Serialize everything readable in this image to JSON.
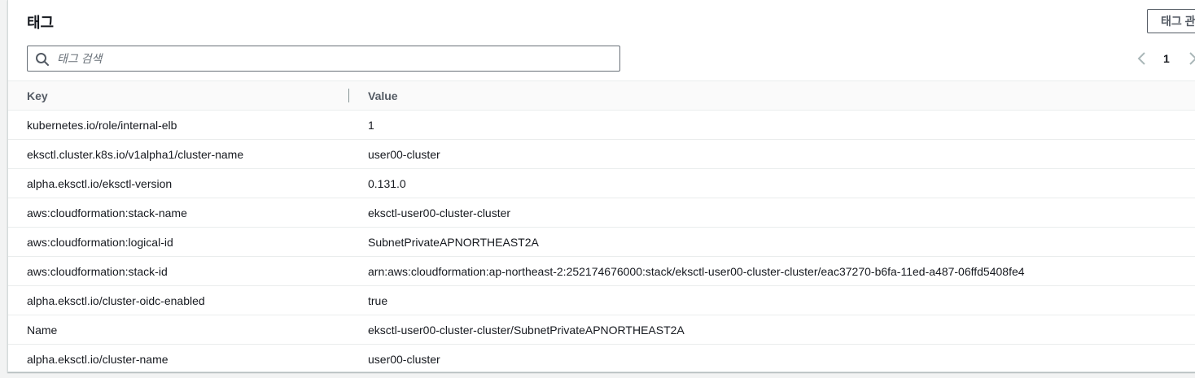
{
  "panel": {
    "title": "태그",
    "manage_button_label": "태그 관리"
  },
  "search": {
    "placeholder": "태그 검색",
    "value": ""
  },
  "pagination": {
    "current_page": "1"
  },
  "table": {
    "columns": [
      "Key",
      "Value"
    ],
    "rows": [
      {
        "key": "kubernetes.io/role/internal-elb",
        "value": "1"
      },
      {
        "key": "eksctl.cluster.k8s.io/v1alpha1/cluster-name",
        "value": "user00-cluster"
      },
      {
        "key": "alpha.eksctl.io/eksctl-version",
        "value": "0.131.0"
      },
      {
        "key": "aws:cloudformation:stack-name",
        "value": "eksctl-user00-cluster-cluster"
      },
      {
        "key": "aws:cloudformation:logical-id",
        "value": "SubnetPrivateAPNORTHEAST2A"
      },
      {
        "key": "aws:cloudformation:stack-id",
        "value": "arn:aws:cloudformation:ap-northeast-2:252174676000:stack/eksctl-user00-cluster-cluster/eac37270-b6fa-11ed-a487-06ffd5408fe4"
      },
      {
        "key": "alpha.eksctl.io/cluster-oidc-enabled",
        "value": "true"
      },
      {
        "key": "Name",
        "value": "eksctl-user00-cluster-cluster/SubnetPrivateAPNORTHEAST2A"
      },
      {
        "key": "alpha.eksctl.io/cluster-name",
        "value": "user00-cluster"
      }
    ]
  },
  "icons": {
    "search": "search-icon",
    "prev": "chevron-left-icon",
    "next": "chevron-right-icon"
  },
  "colors": {
    "text": "#16191f",
    "header_text": "#545b64",
    "border": "#eaeded",
    "disabled": "#879596"
  }
}
